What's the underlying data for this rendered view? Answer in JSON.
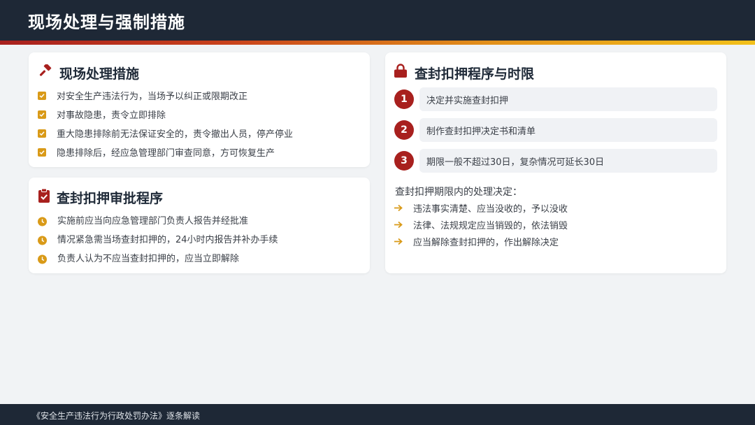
{
  "header": {
    "title": "现场处理与强制措施"
  },
  "onsite": {
    "title": "现场处理措施",
    "icon": "gavel-icon",
    "items": [
      "对安全生产违法行为，当场予以纠正或限期改正",
      "对事故隐患，责令立即排除",
      "重大隐患排除前无法保证安全的，责令撤出人员，停产停业",
      "隐患排除后，经应急管理部门审查同意，方可恢复生产"
    ]
  },
  "approval": {
    "title": "查封扣押审批程序",
    "icon": "clipboard-check-icon",
    "items": [
      "实施前应当向应急管理部门负责人报告并经批准",
      "情况紧急需当场查封扣押的，24小时内报告并补办手续",
      "负责人认为不应当查封扣押的，应当立即解除"
    ]
  },
  "procedure": {
    "title": "查封扣押程序与时限",
    "icon": "lock-icon",
    "steps": [
      {
        "num": "1",
        "text": "决定并实施查封扣押"
      },
      {
        "num": "2",
        "text": "制作查封扣押决定书和清单"
      },
      {
        "num": "3",
        "text": "期限一般不超过30日，复杂情况可延长30日"
      }
    ],
    "subheading": "查封扣押期限内的处理决定：",
    "decisions": [
      "违法事实清楚、应当没收的，予以没收",
      "法律、法规规定应当销毁的，依法销毁",
      "应当解除查封扣押的，作出解除决定"
    ]
  },
  "footer": {
    "text": "《安全生产违法行为行政处罚办法》逐条解读"
  },
  "colors": {
    "header_bg": "#1e2836",
    "brand_red": "#a8201e",
    "accent_gold": "#d99a18",
    "card_bg": "#ffffff",
    "page_bg": "#f1f3f5"
  }
}
